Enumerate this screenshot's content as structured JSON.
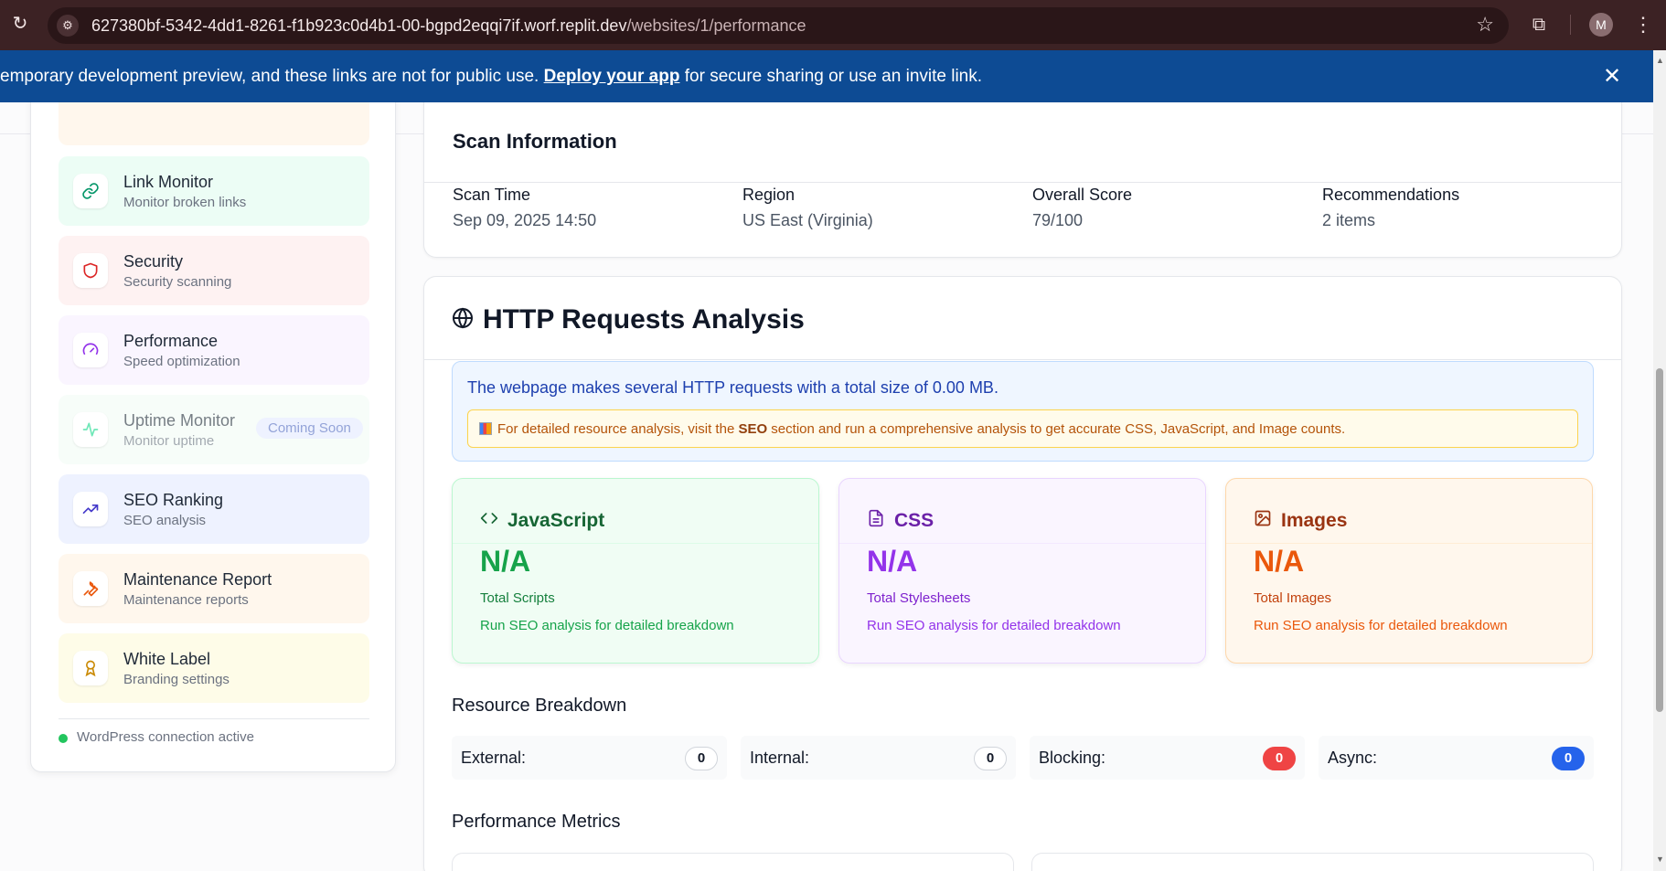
{
  "browser": {
    "url_host": "627380bf-5342-4dd1-8261-f1b923c0d4b1-00-bgpd2eqqi7if.worf.replit.dev",
    "url_path": "/websites/1/performance",
    "avatar_initial": "M"
  },
  "banner": {
    "text_before": "emporary development preview, and these links are not for public use. ",
    "link": "Deploy your app",
    "text_after": " for secure sharing or use an invite link."
  },
  "sidebar": {
    "items": [
      {
        "title": "Link Monitor",
        "sub": "Monitor broken links",
        "icon": "link-icon",
        "color": "#ecfdf5"
      },
      {
        "title": "Security",
        "sub": "Security scanning",
        "icon": "shield-icon",
        "color": "#fef2f2"
      },
      {
        "title": "Performance",
        "sub": "Speed optimization",
        "icon": "gauge-icon",
        "color": "#faf5ff"
      },
      {
        "title": "Uptime Monitor",
        "sub": "Monitor uptime",
        "icon": "activity-icon",
        "color": "#f0fdf4",
        "badge": "Coming Soon"
      },
      {
        "title": "SEO Ranking",
        "sub": "SEO analysis",
        "icon": "trending-up-icon",
        "color": "#eef2ff"
      },
      {
        "title": "Maintenance Report",
        "sub": "Maintenance reports",
        "icon": "wrench-icon",
        "color": "#fff7ed"
      },
      {
        "title": "White Label",
        "sub": "Branding settings",
        "icon": "award-icon",
        "color": "#fefce8"
      }
    ],
    "connection_status": "WordPress connection active"
  },
  "scan": {
    "title": "Scan Information",
    "fields": [
      {
        "label": "Scan Time",
        "value": "Sep 09, 2025 14:50"
      },
      {
        "label": "Region",
        "value": "US East (Virginia)"
      },
      {
        "label": "Overall Score",
        "value": "79/100"
      },
      {
        "label": "Recommendations",
        "value": "2 items"
      }
    ]
  },
  "http": {
    "title": "HTTP Requests Analysis",
    "summary": "The webpage makes several HTTP requests with a total size of 0.00 MB.",
    "note_before": "For detailed resource analysis, visit the ",
    "note_bold": "SEO",
    "note_after": " section and run a comprehensive analysis to get accurate CSS, JavaScript, and Image counts.",
    "resources": [
      {
        "title": "JavaScript",
        "value": "N/A",
        "label": "Total Scripts",
        "hint": "Run SEO analysis for detailed breakdown"
      },
      {
        "title": "CSS",
        "value": "N/A",
        "label": "Total Stylesheets",
        "hint": "Run SEO analysis for detailed breakdown"
      },
      {
        "title": "Images",
        "value": "N/A",
        "label": "Total Images",
        "hint": "Run SEO analysis for detailed breakdown"
      }
    ],
    "breakdown_title": "Resource Breakdown",
    "breakdown": [
      {
        "label": "External:",
        "value": "0"
      },
      {
        "label": "Internal:",
        "value": "0"
      },
      {
        "label": "Blocking:",
        "value": "0"
      },
      {
        "label": "Async:",
        "value": "0"
      }
    ],
    "metrics_title": "Performance Metrics"
  }
}
